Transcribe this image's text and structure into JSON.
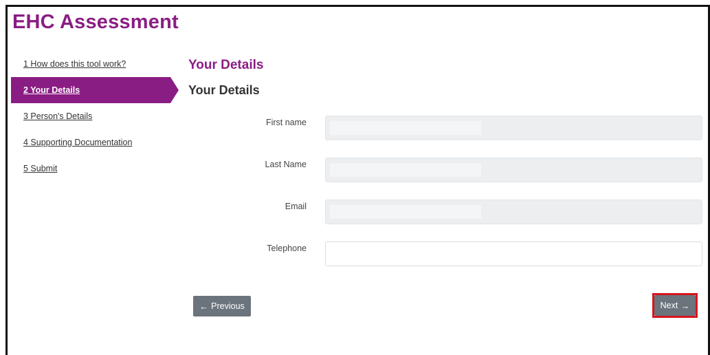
{
  "app": {
    "title": "EHC Assessment"
  },
  "steps": [
    {
      "label": "1 How does this tool work?",
      "active": false
    },
    {
      "label": "2 Your Details",
      "active": true
    },
    {
      "label": "3 Person's Details",
      "active": false
    },
    {
      "label": "4 Supporting Documentation",
      "active": false
    },
    {
      "label": "5 Submit",
      "active": false
    }
  ],
  "section": {
    "heading": "Your Details",
    "subheading": "Your Details"
  },
  "form": {
    "first_name": {
      "label": "First name",
      "value": ""
    },
    "last_name": {
      "label": "Last Name",
      "value": ""
    },
    "email": {
      "label": "Email",
      "value": ""
    },
    "telephone": {
      "label": "Telephone",
      "value": ""
    }
  },
  "buttons": {
    "previous_label": "Previous",
    "next_label": "Next"
  },
  "colors": {
    "brand": "#8a1d84",
    "button": "#6b747c",
    "highlight": "#d7141a"
  },
  "icons": {
    "previous": "arrow-left-icon",
    "next": "arrow-right-icon"
  }
}
